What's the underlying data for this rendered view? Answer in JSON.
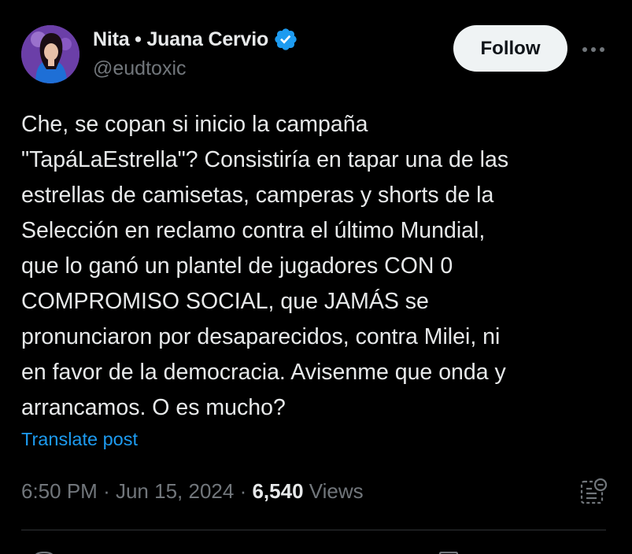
{
  "author": {
    "display_name": "Nita • Juana Cervio",
    "handle": "@eudtoxic",
    "avatar_icon": "profile-photo",
    "verified_color": "#1d9bf0"
  },
  "follow_label": "Follow",
  "more_icon": "ellipsis-icon",
  "tweet": {
    "lines": [
      "Che, se copan si inicio la campaña",
      "\"TapáLaEstrella\"?  Consistiría en tapar una de las",
      "estrellas de camisetas, camperas y shorts de la",
      "Selección en reclamo contra el último Mundial,",
      "que lo ganó un plantel de jugadores CON 0",
      "COMPROMISO SOCIAL, que JAMÁS se",
      "pronunciaron por desaparecidos, contra Milei, ni",
      "en favor de la democracia. Avisenme que onda y",
      "arrancamos. O es mucho?"
    ]
  },
  "translate_label": "Translate post",
  "meta": {
    "time": "6:50 PM",
    "separator": "·",
    "date": "Jun 15, 2024",
    "views_count": "6,540",
    "views_label": "Views"
  },
  "colors": {
    "background": "#000000",
    "text": "#e7e9ea",
    "muted": "#71767b",
    "link": "#1d9bf0",
    "button_bg": "#eff3f4"
  }
}
